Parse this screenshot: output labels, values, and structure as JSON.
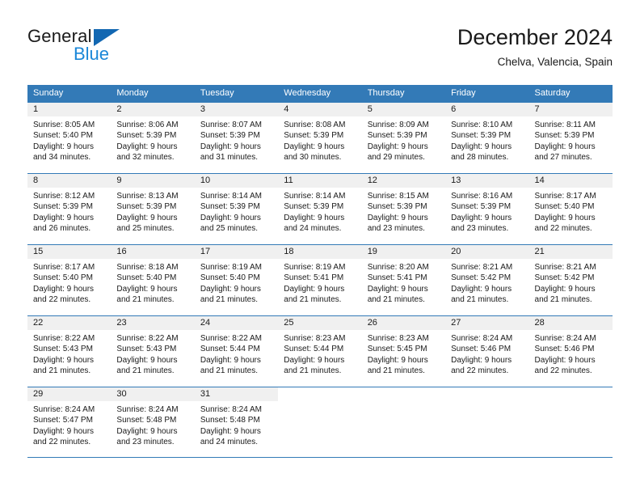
{
  "brand": {
    "name_top": "General",
    "name_bottom": "Blue",
    "triangle_color": "#1267b2",
    "blue_color": "#1a87d8"
  },
  "header": {
    "title": "December 2024",
    "subtitle": "Chelva, Valencia, Spain"
  },
  "theme": {
    "header_row_bg": "#337ab7",
    "header_row_text": "#ffffff",
    "daynum_bg": "#f0f0f0",
    "rule_color": "#337ab7",
    "body_text": "#1a1a1a"
  },
  "weekdays": [
    "Sunday",
    "Monday",
    "Tuesday",
    "Wednesday",
    "Thursday",
    "Friday",
    "Saturday"
  ],
  "weeks": [
    [
      {
        "day": "1",
        "sunrise": "Sunrise: 8:05 AM",
        "sunset": "Sunset: 5:40 PM",
        "daylight1": "Daylight: 9 hours",
        "daylight2": "and 34 minutes."
      },
      {
        "day": "2",
        "sunrise": "Sunrise: 8:06 AM",
        "sunset": "Sunset: 5:39 PM",
        "daylight1": "Daylight: 9 hours",
        "daylight2": "and 32 minutes."
      },
      {
        "day": "3",
        "sunrise": "Sunrise: 8:07 AM",
        "sunset": "Sunset: 5:39 PM",
        "daylight1": "Daylight: 9 hours",
        "daylight2": "and 31 minutes."
      },
      {
        "day": "4",
        "sunrise": "Sunrise: 8:08 AM",
        "sunset": "Sunset: 5:39 PM",
        "daylight1": "Daylight: 9 hours",
        "daylight2": "and 30 minutes."
      },
      {
        "day": "5",
        "sunrise": "Sunrise: 8:09 AM",
        "sunset": "Sunset: 5:39 PM",
        "daylight1": "Daylight: 9 hours",
        "daylight2": "and 29 minutes."
      },
      {
        "day": "6",
        "sunrise": "Sunrise: 8:10 AM",
        "sunset": "Sunset: 5:39 PM",
        "daylight1": "Daylight: 9 hours",
        "daylight2": "and 28 minutes."
      },
      {
        "day": "7",
        "sunrise": "Sunrise: 8:11 AM",
        "sunset": "Sunset: 5:39 PM",
        "daylight1": "Daylight: 9 hours",
        "daylight2": "and 27 minutes."
      }
    ],
    [
      {
        "day": "8",
        "sunrise": "Sunrise: 8:12 AM",
        "sunset": "Sunset: 5:39 PM",
        "daylight1": "Daylight: 9 hours",
        "daylight2": "and 26 minutes."
      },
      {
        "day": "9",
        "sunrise": "Sunrise: 8:13 AM",
        "sunset": "Sunset: 5:39 PM",
        "daylight1": "Daylight: 9 hours",
        "daylight2": "and 25 minutes."
      },
      {
        "day": "10",
        "sunrise": "Sunrise: 8:14 AM",
        "sunset": "Sunset: 5:39 PM",
        "daylight1": "Daylight: 9 hours",
        "daylight2": "and 25 minutes."
      },
      {
        "day": "11",
        "sunrise": "Sunrise: 8:14 AM",
        "sunset": "Sunset: 5:39 PM",
        "daylight1": "Daylight: 9 hours",
        "daylight2": "and 24 minutes."
      },
      {
        "day": "12",
        "sunrise": "Sunrise: 8:15 AM",
        "sunset": "Sunset: 5:39 PM",
        "daylight1": "Daylight: 9 hours",
        "daylight2": "and 23 minutes."
      },
      {
        "day": "13",
        "sunrise": "Sunrise: 8:16 AM",
        "sunset": "Sunset: 5:39 PM",
        "daylight1": "Daylight: 9 hours",
        "daylight2": "and 23 minutes."
      },
      {
        "day": "14",
        "sunrise": "Sunrise: 8:17 AM",
        "sunset": "Sunset: 5:40 PM",
        "daylight1": "Daylight: 9 hours",
        "daylight2": "and 22 minutes."
      }
    ],
    [
      {
        "day": "15",
        "sunrise": "Sunrise: 8:17 AM",
        "sunset": "Sunset: 5:40 PM",
        "daylight1": "Daylight: 9 hours",
        "daylight2": "and 22 minutes."
      },
      {
        "day": "16",
        "sunrise": "Sunrise: 8:18 AM",
        "sunset": "Sunset: 5:40 PM",
        "daylight1": "Daylight: 9 hours",
        "daylight2": "and 21 minutes."
      },
      {
        "day": "17",
        "sunrise": "Sunrise: 8:19 AM",
        "sunset": "Sunset: 5:40 PM",
        "daylight1": "Daylight: 9 hours",
        "daylight2": "and 21 minutes."
      },
      {
        "day": "18",
        "sunrise": "Sunrise: 8:19 AM",
        "sunset": "Sunset: 5:41 PM",
        "daylight1": "Daylight: 9 hours",
        "daylight2": "and 21 minutes."
      },
      {
        "day": "19",
        "sunrise": "Sunrise: 8:20 AM",
        "sunset": "Sunset: 5:41 PM",
        "daylight1": "Daylight: 9 hours",
        "daylight2": "and 21 minutes."
      },
      {
        "day": "20",
        "sunrise": "Sunrise: 8:21 AM",
        "sunset": "Sunset: 5:42 PM",
        "daylight1": "Daylight: 9 hours",
        "daylight2": "and 21 minutes."
      },
      {
        "day": "21",
        "sunrise": "Sunrise: 8:21 AM",
        "sunset": "Sunset: 5:42 PM",
        "daylight1": "Daylight: 9 hours",
        "daylight2": "and 21 minutes."
      }
    ],
    [
      {
        "day": "22",
        "sunrise": "Sunrise: 8:22 AM",
        "sunset": "Sunset: 5:43 PM",
        "daylight1": "Daylight: 9 hours",
        "daylight2": "and 21 minutes."
      },
      {
        "day": "23",
        "sunrise": "Sunrise: 8:22 AM",
        "sunset": "Sunset: 5:43 PM",
        "daylight1": "Daylight: 9 hours",
        "daylight2": "and 21 minutes."
      },
      {
        "day": "24",
        "sunrise": "Sunrise: 8:22 AM",
        "sunset": "Sunset: 5:44 PM",
        "daylight1": "Daylight: 9 hours",
        "daylight2": "and 21 minutes."
      },
      {
        "day": "25",
        "sunrise": "Sunrise: 8:23 AM",
        "sunset": "Sunset: 5:44 PM",
        "daylight1": "Daylight: 9 hours",
        "daylight2": "and 21 minutes."
      },
      {
        "day": "26",
        "sunrise": "Sunrise: 8:23 AM",
        "sunset": "Sunset: 5:45 PM",
        "daylight1": "Daylight: 9 hours",
        "daylight2": "and 21 minutes."
      },
      {
        "day": "27",
        "sunrise": "Sunrise: 8:24 AM",
        "sunset": "Sunset: 5:46 PM",
        "daylight1": "Daylight: 9 hours",
        "daylight2": "and 22 minutes."
      },
      {
        "day": "28",
        "sunrise": "Sunrise: 8:24 AM",
        "sunset": "Sunset: 5:46 PM",
        "daylight1": "Daylight: 9 hours",
        "daylight2": "and 22 minutes."
      }
    ],
    [
      {
        "day": "29",
        "sunrise": "Sunrise: 8:24 AM",
        "sunset": "Sunset: 5:47 PM",
        "daylight1": "Daylight: 9 hours",
        "daylight2": "and 22 minutes."
      },
      {
        "day": "30",
        "sunrise": "Sunrise: 8:24 AM",
        "sunset": "Sunset: 5:48 PM",
        "daylight1": "Daylight: 9 hours",
        "daylight2": "and 23 minutes."
      },
      {
        "day": "31",
        "sunrise": "Sunrise: 8:24 AM",
        "sunset": "Sunset: 5:48 PM",
        "daylight1": "Daylight: 9 hours",
        "daylight2": "and 24 minutes."
      },
      {
        "day": "",
        "sunrise": "",
        "sunset": "",
        "daylight1": "",
        "daylight2": ""
      },
      {
        "day": "",
        "sunrise": "",
        "sunset": "",
        "daylight1": "",
        "daylight2": ""
      },
      {
        "day": "",
        "sunrise": "",
        "sunset": "",
        "daylight1": "",
        "daylight2": ""
      },
      {
        "day": "",
        "sunrise": "",
        "sunset": "",
        "daylight1": "",
        "daylight2": ""
      }
    ]
  ]
}
